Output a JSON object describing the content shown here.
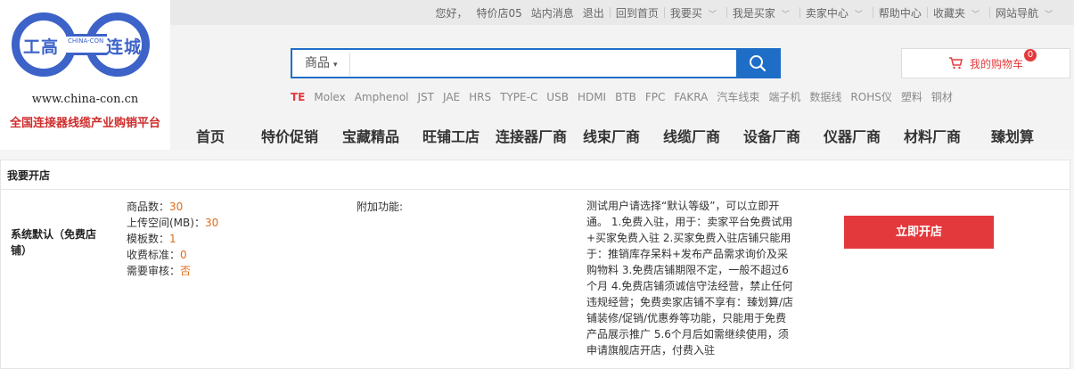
{
  "header": {
    "logo": {
      "left_text": "工高",
      "right_text": "连城",
      "mini": "CHINA-CON",
      "url": "www.china-con.cn",
      "slogan": "全国连接器线缆产业购销平台"
    },
    "topnav": {
      "greeting": "您好，",
      "user": "特价店05",
      "messages": "站内消息",
      "logout": "退出",
      "home": "回到首页",
      "buy": "我要买",
      "buyer": "我是买家",
      "seller": "卖家中心",
      "help": "帮助中心",
      "favorites": "收藏夹",
      "sitenav": "网站导航"
    },
    "search": {
      "category": "商品",
      "placeholder": "",
      "value": ""
    },
    "hot_keywords": [
      "TE",
      "Molex",
      "Amphenol",
      "JST",
      "JAE",
      "HRS",
      "TYPE-C",
      "USB",
      "HDMI",
      "BTB",
      "FPC",
      "FAKRA",
      "汽车线束",
      "端子机",
      "数据线",
      "ROHS仪",
      "塑料",
      "铜材"
    ],
    "cart": {
      "label": "我的购物车",
      "count": "0"
    },
    "mainnav": [
      "首页",
      "特价促销",
      "宝藏精品",
      "旺铺工店",
      "连接器厂商",
      "线束厂商",
      "线缆厂商",
      "设备厂商",
      "仪器厂商",
      "材料厂商",
      "臻划算"
    ]
  },
  "panel": {
    "title": "我要开店",
    "plan_name": "系统默认（免费店铺）",
    "specs": [
      {
        "label": "商品数：",
        "value": "30"
      },
      {
        "label": "上传空间(MB)：",
        "value": "30"
      },
      {
        "label": "模板数：",
        "value": "1"
      },
      {
        "label": "收费标准：",
        "value": "0"
      },
      {
        "label": "需要审核：",
        "value": "否"
      }
    ],
    "extra_label": "附加功能:",
    "description": "测试用户请选择“默认等级”，可以立即开通。 1.免费入驻，用于：卖家平台免费试用+买家免费入驻 2.买家免费入驻店铺只能用于：推销库存呆料+发布产品需求询价及采购物料 3.免费店铺期限不定，一般不超过6个月 4.免费店铺须诚信守法经营，禁止任何违规经营；免费卖家店铺不享有：臻划算/店铺装修/促销/优惠券等功能，只能用于免费产品展示推广 5.6个月后如需继续使用，须申请旗舰店开店，付费入驻",
    "button": "立即开店"
  },
  "colors": {
    "accent": "#1e6ec8",
    "danger": "#e4393c",
    "value": "#e06b1a",
    "logo": "#3d63c9"
  }
}
